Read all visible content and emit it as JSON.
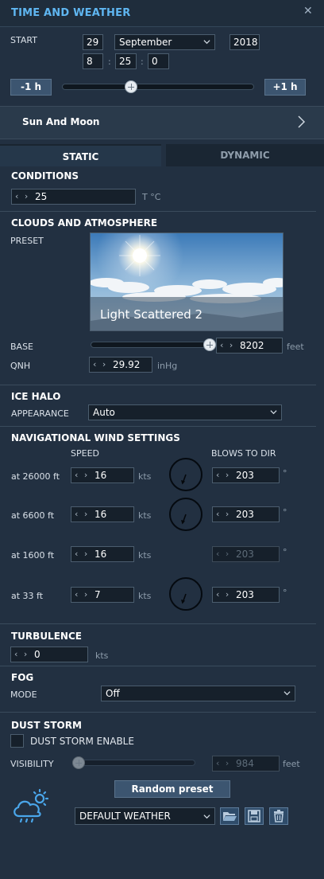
{
  "header": {
    "title": "TIME AND WEATHER",
    "close_icon": "close-icon"
  },
  "start": {
    "label": "START",
    "day": "29",
    "month": "September",
    "year": "2018",
    "hour": "8",
    "minute": "25",
    "second": "0",
    "sep1": ":",
    "sep2": ":",
    "minus_btn": "-1 h",
    "plus_btn": "+1 h",
    "time_slider_fraction": 0.35
  },
  "sun_moon": {
    "label": "Sun And Moon"
  },
  "tabs": [
    {
      "label": "STATIC",
      "active": true
    },
    {
      "label": "DYNAMIC",
      "active": false
    }
  ],
  "conditions": {
    "title": "CONDITIONS",
    "temperature": "25",
    "unit": "T °C"
  },
  "clouds": {
    "title": "CLOUDS AND ATMOSPHERE",
    "preset_label": "PRESET",
    "preset_name": "Light Scattered 2",
    "base_label": "BASE",
    "base_value": "8202",
    "base_unit": "feet",
    "base_slider_fraction": 1.0,
    "qnh_label": "QNH",
    "qnh_value": "29.92",
    "qnh_unit": "inHg"
  },
  "ice_halo": {
    "title": "ICE HALO",
    "appearance_label": "APPEARANCE",
    "appearance_value": "Auto"
  },
  "wind": {
    "title": "NAVIGATIONAL WIND SETTINGS",
    "speed_header": "SPEED",
    "dir_header": "BLOWS TO DIR",
    "unit": "kts",
    "deg": "°",
    "rows": [
      {
        "altitude": "at 26000 ft",
        "speed": "16",
        "dir": "203",
        "enabled": true
      },
      {
        "altitude": "at 6600 ft",
        "speed": "16",
        "dir": "203",
        "enabled": true
      },
      {
        "altitude": "at 1600 ft",
        "speed": "16",
        "dir": "203",
        "enabled": false
      },
      {
        "altitude": "at 33 ft",
        "speed": "7",
        "dir": "203",
        "enabled": true
      }
    ]
  },
  "turbulence": {
    "title": "TURBULENCE",
    "value": "0",
    "unit": "kts"
  },
  "fog": {
    "title": "FOG",
    "mode_label": "MODE",
    "mode_value": "Off"
  },
  "dust": {
    "title": "DUST STORM",
    "enable_label": "DUST STORM ENABLE",
    "enabled": false,
    "visibility_label": "VISIBILITY",
    "visibility_value": "984",
    "visibility_unit": "feet",
    "visibility_slider_fraction": 0.0
  },
  "footer": {
    "random_btn": "Random preset",
    "weather_preset": "DEFAULT WEATHER",
    "icons": [
      "weather-cloud-sun-icon",
      "folder-open-icon",
      "save-icon",
      "trash-icon"
    ]
  },
  "colors": {
    "accent": "#5fb6f1",
    "panel": "#223041",
    "button": "#3c5570"
  }
}
